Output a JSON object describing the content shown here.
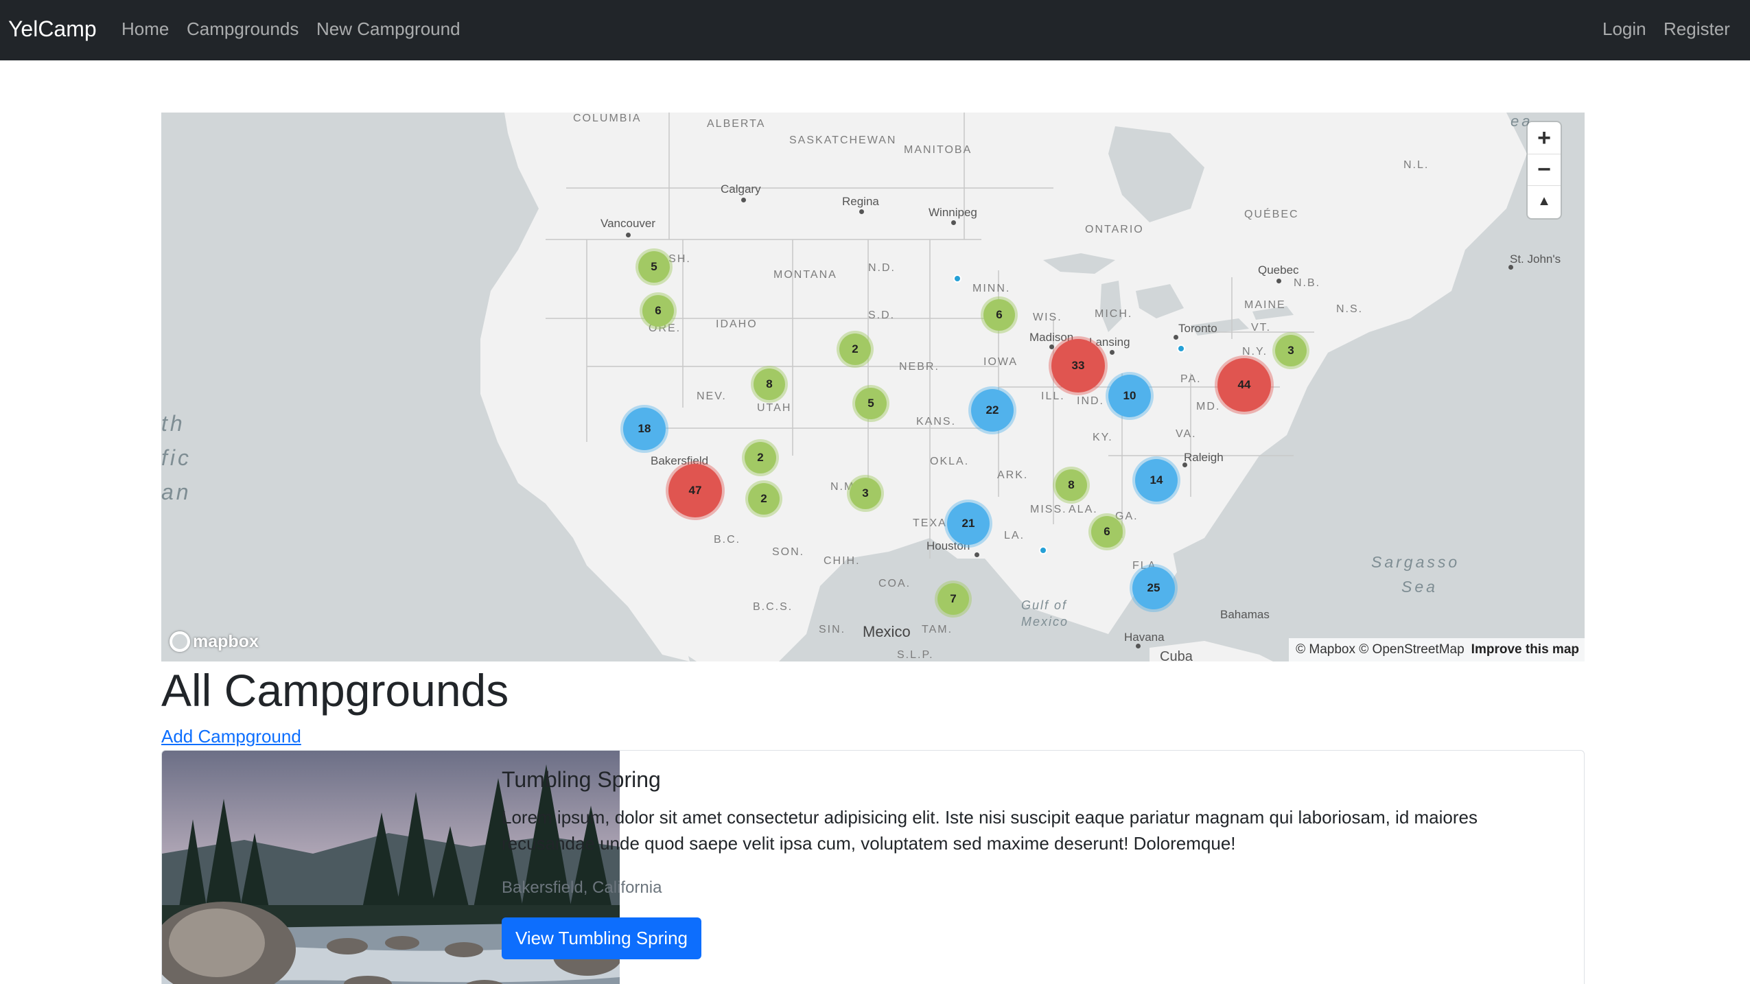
{
  "navbar": {
    "brand": "YelCamp",
    "links": [
      "Home",
      "Campgrounds",
      "New Campground"
    ],
    "auth": [
      "Login",
      "Register"
    ]
  },
  "map": {
    "attribution": "© Mapbox © OpenStreetMap",
    "improve_link": "Improve this map",
    "logo_text": "mapbox",
    "zoom_in": "+",
    "zoom_out": "−",
    "compass": "▲",
    "region_labels": [
      "COLUMBIA",
      "ALBERTA",
      "SASKATCHEWAN",
      "MANITOBA",
      "ONTARIO",
      "QUÉBEC",
      "N.L.",
      "N.B.",
      "N.S.",
      "MAINE",
      "VT.",
      "N.Y.",
      "PA.",
      "MD.",
      "VA.",
      "KY.",
      "IND.",
      "ILL.",
      "MICH.",
      "WIS.",
      "IOWA",
      "MINN.",
      "N.D.",
      "S.D.",
      "NEBR.",
      "KANS.",
      "OKLA.",
      "ARK.",
      "TEXAS",
      "LA.",
      "MISS.",
      "ALA.",
      "GA.",
      "FLA.",
      "N.M.",
      "UTAH",
      "NEV.",
      "IDAHO",
      "MONTANA",
      "WASH.",
      "ORE.",
      "SON.",
      "CHIH.",
      "COA.",
      "TAM.",
      "SIN.",
      "B.C.",
      "B.C.S.",
      "S.L.P."
    ],
    "city_labels": [
      "Calgary",
      "Regina",
      "Winnipeg",
      "Vancouver",
      "Quebec",
      "St. John's",
      "Toronto",
      "Lansing",
      "Madison",
      "Raleigh",
      "Houston",
      "Bakersfield",
      "Havana",
      "Bahamas",
      "Mexico",
      "Cuba"
    ],
    "water_labels": [
      "Sargasso",
      "Sea",
      "Gulf of",
      "Mexico",
      "th",
      "fic",
      "an",
      "ea"
    ],
    "clusters": [
      {
        "count": 5,
        "tier": "green"
      },
      {
        "count": 6,
        "tier": "green"
      },
      {
        "count": 2,
        "tier": "green"
      },
      {
        "count": 8,
        "tier": "green"
      },
      {
        "count": 5,
        "tier": "green"
      },
      {
        "count": 6,
        "tier": "green"
      },
      {
        "count": 33,
        "tier": "red"
      },
      {
        "count": 10,
        "tier": "blue"
      },
      {
        "count": 3,
        "tier": "green"
      },
      {
        "count": 44,
        "tier": "red"
      },
      {
        "count": 22,
        "tier": "blue"
      },
      {
        "count": 18,
        "tier": "blue"
      },
      {
        "count": 2,
        "tier": "green"
      },
      {
        "count": 47,
        "tier": "red"
      },
      {
        "count": 2,
        "tier": "green"
      },
      {
        "count": 3,
        "tier": "green"
      },
      {
        "count": 8,
        "tier": "green"
      },
      {
        "count": 14,
        "tier": "blue"
      },
      {
        "count": 21,
        "tier": "blue"
      },
      {
        "count": 6,
        "tier": "green"
      },
      {
        "count": 25,
        "tier": "blue"
      },
      {
        "count": 7,
        "tier": "green"
      }
    ]
  },
  "page": {
    "title": "All Campgrounds",
    "add_link": "Add Campground"
  },
  "campgrounds": [
    {
      "title": "Tumbling Spring",
      "description": "Lorem ipsum, dolor sit amet consectetur adipisicing elit. Iste nisi suscipit eaque pariatur magnam qui laboriosam, id maiores recusandae unde quod saepe velit ipsa cum, voluptatem sed maxime deserunt! Doloremque!",
      "location": "Bakersfield, California",
      "button": "View Tumbling Spring"
    }
  ],
  "colors": {
    "navbar_bg": "#212529",
    "primary": "#0d6efd",
    "cluster_green": "#a2c964",
    "cluster_blue": "#51b2ec",
    "cluster_red": "#e05550"
  }
}
